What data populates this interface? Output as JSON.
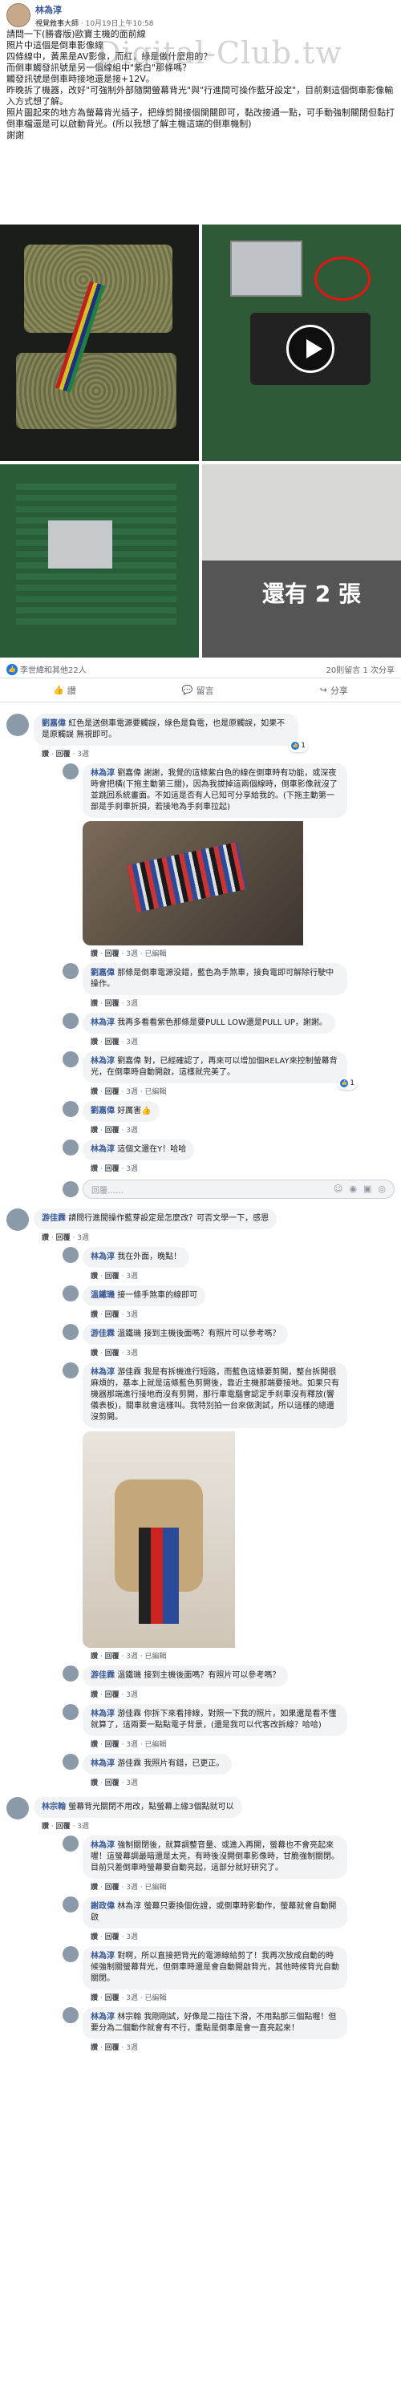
{
  "post": {
    "author": "林為淳",
    "group": "視覺敘事大師",
    "time": "10月19日上午10:58",
    "lines": [
      "請問一下(勝睿版)歐寶主機的面前線",
      "照片中這個是倒車影像線",
      "四條線中，黃黑是AV影像，而紅，綠是做什麼用的？",
      "而倒車觸發訊號是另一個線組中\"紫白\"那條嗎？",
      "觸發訊號是倒車時接地還是接+12V。",
      "昨晚拆了機器，改好\"可強制外部隨開螢幕背光\"與\"行進間可操作藍牙設定\"，目前剩這個倒車影像輸入方式想了解。",
      "照片圖起來的地方為螢幕背光插子，把綠剪開接個開關即可，黏改接通一點，可手動強制關閉但黏打倒車檔還是可以啟動背光。(所以我想了解主機這端的倒車機制)",
      "謝謝"
    ],
    "watermark": "Digital-Club.tw",
    "more_photos": "還有 2 張"
  },
  "reactions": {
    "likes": "李世緯和其他22人",
    "counts": "20則留言 1 次分享"
  },
  "actions": {
    "like": "讚",
    "comment": "留言",
    "share": "分享"
  },
  "comments": [
    {
      "name": "劉嘉偉",
      "text": "紅色是送倒車電源要觸誤，綠色是負電，也是原觸誤，如果不是原觸誤 無視即可。",
      "links": [
        "讚",
        "回覆",
        "3週"
      ],
      "likes": "1"
    },
    {
      "name": "林為淳",
      "text": "劉嘉偉 謝謝，我覺的這條紫白色的線在倒車時有功能，或深夜時會把橫(下拖主動第三關)，因為我拔掉這兩個線時，倒車影像就沒了並跳回系統畫面。不如這是否有人已知可分享給我的。(下拖主動第一部是手刹車折損，若接地為手刹車拉起)",
      "links": [
        "讚",
        "回覆",
        "3週",
        "已編輯"
      ]
    },
    {
      "name": "劉嘉偉",
      "text": "那條是倒車電源没錯，藍色為手煞車，接負電即可解除行駛中操作。",
      "links": [
        "讚",
        "回覆",
        "3週"
      ]
    },
    {
      "name": "林為淳",
      "text": "我再多看看紫色那條是要PULL LOW還是PULL UP，謝謝。",
      "links": [
        "讚",
        "回覆",
        "3週"
      ]
    },
    {
      "name": "林為淳",
      "text": "劉嘉偉 對，已經確認了，再來可以增加個RELAY來控制螢幕背光，在倒車時自動開啟，這樣就完美了。",
      "links": [
        "讚",
        "回覆",
        "3週",
        "已編輯"
      ],
      "likes": "1"
    },
    {
      "name": "劉嘉偉",
      "text": "好厲害👍",
      "links": [
        "讚",
        "回覆",
        "3週"
      ]
    },
    {
      "name": "林為淳",
      "text": "這個文還在Y！哈哈",
      "links": [
        "讚",
        "回覆",
        "3週"
      ]
    },
    {
      "name": "游佳霖",
      "text": "請問行進間操作藍芽設定是怎麼改？可否文學一下，感恩",
      "links": [
        "讚",
        "回覆",
        "3週"
      ]
    },
    {
      "name": "林為淳",
      "text": "我在外面，晚點！",
      "links": [
        "讚",
        "回覆",
        "3週"
      ]
    },
    {
      "name": "溫鐵璣",
      "text": "接一條手煞車的線即可",
      "links": [
        "讚",
        "回覆",
        "3週"
      ]
    },
    {
      "name": "游佳霖",
      "text": "溫鐵璣 接到主機後面嗎？有照片可以參考嗎？",
      "links": [
        "讚",
        "回覆",
        "3週"
      ]
    },
    {
      "name": "林為淳",
      "text": "游佳霖 我是有拆機進行短路，而藍色這條要剪開，整台拆開很麻煩的，基本上就是這條藍色剪開後，靠近主機那端要接地。如果只有機器那端進行接地而沒有剪開，那行車電腦會認定手刹車沒有釋放(響儀表板)，關車就會這樣叫。我特別拍一台來做測試，所以這樣的總還沒剪開。",
      "links": [
        "讚",
        "回覆",
        "3週",
        "已編輯"
      ]
    },
    {
      "name": "游佳霖",
      "text": "溫鐵璣 接到主機後面嗎？有照片可以參考嗎？",
      "links": [
        "讚",
        "回覆",
        "3週"
      ]
    },
    {
      "name": "林為淳",
      "text": "游佳霖 你拆下來看排線，對照一下我的照片，如果還是看不懂就算了，這兩要一點點電子背景，(還是我可以代客改拆線？哈哈)",
      "links": [
        "讚",
        "回覆",
        "3週",
        "已編輯"
      ]
    },
    {
      "name": "林為淳",
      "text": "游佳霖 我照片有錯，已更正。",
      "links": [
        "讚",
        "回覆",
        "3週"
      ]
    },
    {
      "name": "林宗翰",
      "text": "螢幕背光關閉不用改，點螢幕上緣3個點就可以",
      "links": [
        "讚",
        "回覆",
        "3週"
      ]
    },
    {
      "name": "林為淳",
      "text": "強制關閉後，就算調整音量、或進入再開，螢幕也不會亮起來喔！這螢幕調最暗還是太亮，有時後沒開倒車影像時，甘脆強制關閉。目前只差倒車時螢幕要自動亮起，這部分就好研究了。",
      "links": [
        "讚",
        "回覆",
        "3週",
        "已編輯"
      ]
    },
    {
      "name": "謝政偉",
      "text": "林為淳 螢幕只要換個佐證，或倒車時影動作，螢幕就會自動開啟",
      "links": [
        "讚",
        "回覆",
        "3週"
      ]
    },
    {
      "name": "林為淳",
      "text": "對啊，所以直接把背光的電源線給剪了！我再次放成自動的時候強制關螢幕背光，但倒車時還是會自動開啟背光，其他時候背光自動關閉。",
      "links": [
        "讚",
        "回覆",
        "3週",
        "已編輯"
      ]
    },
    {
      "name": "林為淳",
      "text": "林宗翰 我剛剛試，好像是二指往下滑，不用點那三個點喔！但要分為二個動作就會有不行，重點是倒車是會一直亮起來！",
      "links": [
        "讚",
        "回覆",
        "3週"
      ]
    }
  ],
  "input": {
    "placeholder": "回覆……"
  }
}
